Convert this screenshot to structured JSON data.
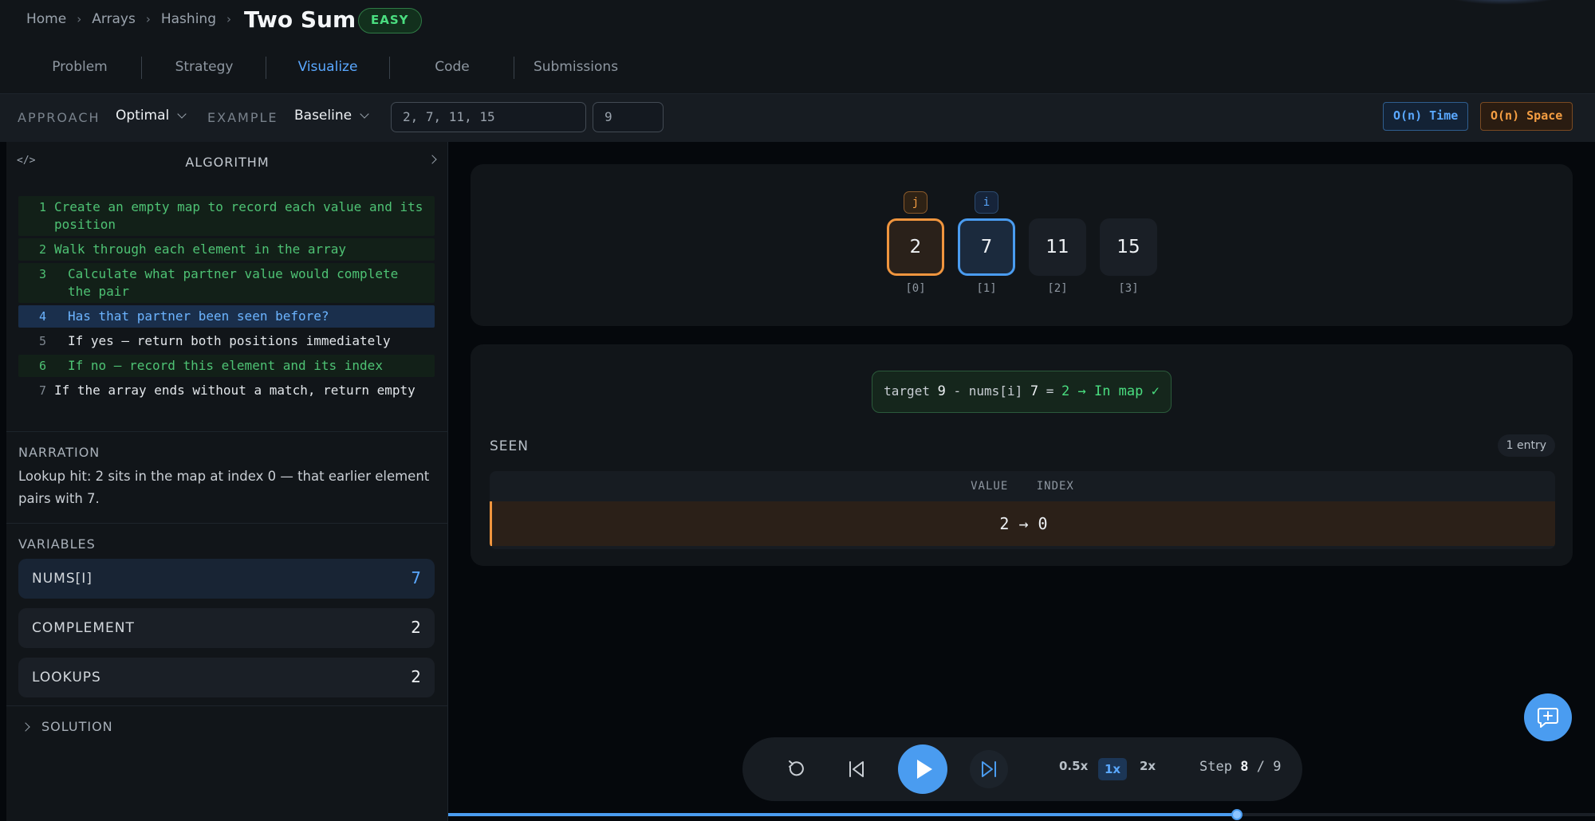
{
  "breadcrumb": [
    {
      "label": "Home"
    },
    {
      "label": "Arrays"
    },
    {
      "label": "Hashing"
    }
  ],
  "title": "Two Sum",
  "difficulty": "EASY",
  "tabs": [
    {
      "label": "Problem",
      "active": false
    },
    {
      "label": "Strategy",
      "active": false
    },
    {
      "label": "Visualize",
      "active": true
    },
    {
      "label": "Code",
      "active": false
    },
    {
      "label": "Submissions",
      "active": false
    }
  ],
  "controls": {
    "approach_label": "APPROACH",
    "approach_value": "Optimal",
    "example_label": "EXAMPLE",
    "example_value": "Baseline",
    "nums_input": "2, 7, 11, 15",
    "target_input": "9",
    "time_complexity": "O(n) Time",
    "space_complexity": "O(n) Space"
  },
  "colors": {
    "accent": "#4a9cf0",
    "pointer_j": "#f0953e",
    "done": "#4ec274",
    "easy": "#4ade80"
  },
  "algorithm": {
    "title": "ALGORITHM",
    "icon": "code-icon",
    "lines": [
      {
        "num": "1",
        "text": "Create an empty map to record each value and its position",
        "state": "done",
        "indent": false
      },
      {
        "num": "2",
        "text": "Walk through each element in the array",
        "state": "done",
        "indent": false
      },
      {
        "num": "3",
        "text": "Calculate what partner value would complete the pair",
        "state": "done",
        "indent": true
      },
      {
        "num": "4",
        "text": "Has that partner been seen before?",
        "state": "current",
        "indent": true
      },
      {
        "num": "5",
        "text": "If yes — return both positions immediately",
        "state": "pending",
        "indent": true
      },
      {
        "num": "6",
        "text": "If no — record this element and its index",
        "state": "done",
        "indent": true
      },
      {
        "num": "7",
        "text": "If the array ends without a match, return empty",
        "state": "pending",
        "indent": false
      }
    ]
  },
  "narration": {
    "label": "NARRATION",
    "text": "Lookup hit: 2 sits in the map at index 0 — that earlier element pairs with 7."
  },
  "variables": {
    "label": "VARIABLES",
    "items": [
      {
        "name": "NUMS[I]",
        "value": "7",
        "highlight": true
      },
      {
        "name": "COMPLEMENT",
        "value": "2",
        "highlight": false
      },
      {
        "name": "LOOKUPS",
        "value": "2",
        "highlight": false
      }
    ]
  },
  "solution_label": "SOLUTION",
  "array": {
    "cells": [
      {
        "value": "2",
        "index": "[0]",
        "pointer": "j"
      },
      {
        "value": "7",
        "index": "[1]",
        "pointer": "i"
      },
      {
        "value": "11",
        "index": "[2]",
        "pointer": ""
      },
      {
        "value": "15",
        "index": "[3]",
        "pointer": ""
      }
    ]
  },
  "formula": {
    "target_label": "target",
    "target": "9",
    "minus": "-",
    "nums_label": "nums[i]",
    "nums_value": "7",
    "equals": "=",
    "result": "2 → In map ✓"
  },
  "seen": {
    "title": "SEEN",
    "count": "1 entry",
    "col_value": "VALUE",
    "col_index": "INDEX",
    "rows": [
      "2 → 0"
    ]
  },
  "playback": {
    "speeds": [
      "0.5x",
      "1x",
      "2x"
    ],
    "active_speed": "1x",
    "step_label": "Step",
    "step_current": "8",
    "step_sep": "/",
    "step_total": "9",
    "progress": 0.6875
  }
}
